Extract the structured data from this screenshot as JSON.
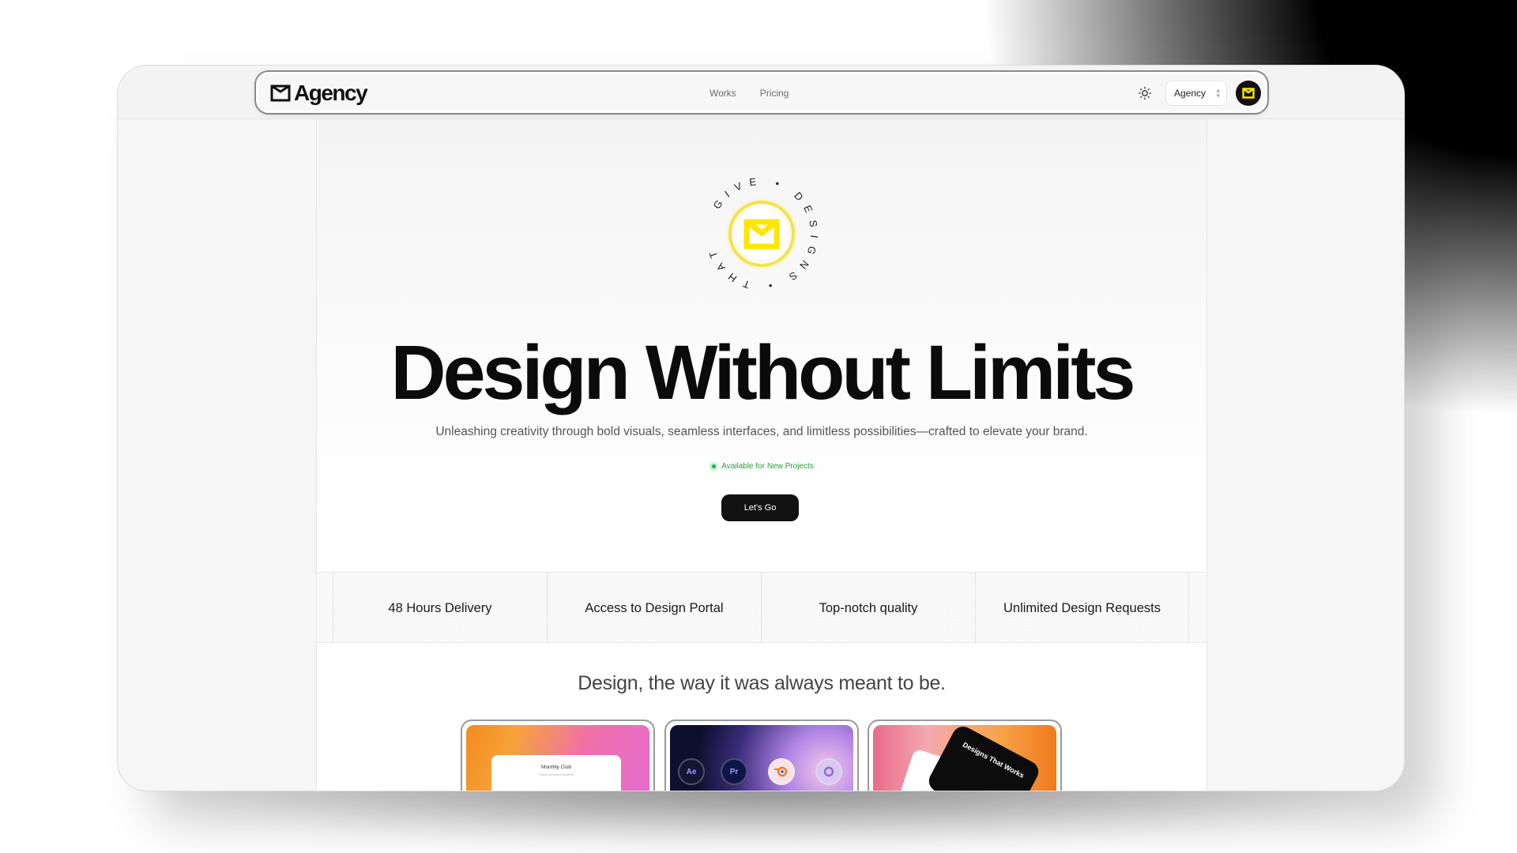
{
  "brand": {
    "name": "Agency",
    "accent": "#FFE600"
  },
  "nav": {
    "links": [
      "Works",
      "Pricing"
    ],
    "workspace_select": "Agency",
    "theme_icon": "sun-icon"
  },
  "badge": {
    "ring_text": "GIVE • DESIGNS • THAT •"
  },
  "hero": {
    "title": "Design Without Limits",
    "subtitle": "Unleashing creativity through bold visuals, seamless interfaces, and limitless possibilities—crafted to elevate your brand.",
    "status": "Available for New Projects",
    "status_color": "#22b14c",
    "cta": "Let's Go"
  },
  "features": [
    "48 Hours Delivery",
    "Access to Design Portal",
    "Top-notch quality",
    "Unlimited Design Requests"
  ],
  "tagline": "Design, the way it was always meant to be.",
  "cards": {
    "card1": {
      "title": "Monthly Club",
      "subtitle": "Pause or cancel anytime"
    },
    "card2": {
      "icons": [
        "Ae",
        "Pr"
      ]
    },
    "card3": {
      "text": "Designs That Works"
    }
  }
}
